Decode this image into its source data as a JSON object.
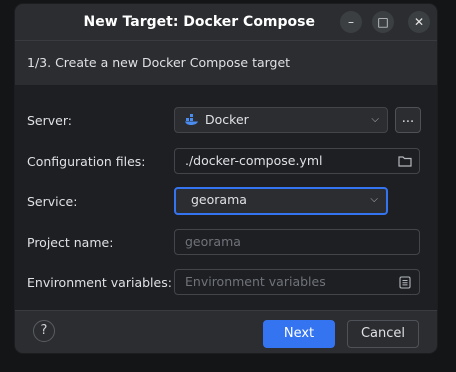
{
  "window": {
    "title": "New Target: Docker Compose",
    "controls": {
      "minimize": "–",
      "maximize": "□",
      "close": "✕"
    }
  },
  "step": {
    "text": "1/3. Create a new Docker Compose target"
  },
  "form": {
    "server": {
      "label": "Server:",
      "value": "Docker",
      "more": "..."
    },
    "config": {
      "label": "Configuration files:",
      "value": "./docker-compose.yml"
    },
    "service": {
      "label": "Service:",
      "value": "georama"
    },
    "project": {
      "label": "Project name:",
      "placeholder": "georama"
    },
    "env": {
      "label": "Environment variables:",
      "placeholder": "Environment variables"
    }
  },
  "footer": {
    "help": "?",
    "next": "Next",
    "cancel": "Cancel"
  },
  "colors": {
    "accent": "#3574f0",
    "docker": "#4a8cf0"
  }
}
